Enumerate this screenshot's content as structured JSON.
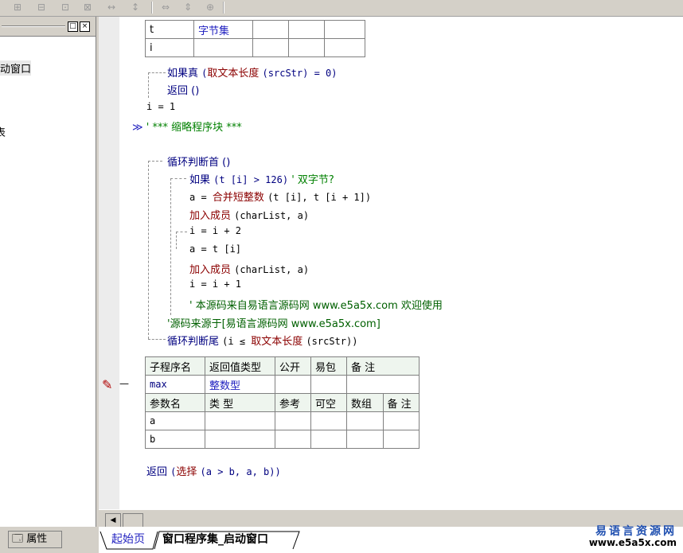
{
  "left_panel": {
    "tree_item_window": "动窗口",
    "tree_item_other": "表",
    "btn_restore": "□",
    "btn_close": "×",
    "properties_tab": "属性"
  },
  "code": {
    "table1": {
      "row1_col1": "t",
      "row1_col2": "字节集",
      "row2_col1": "i"
    },
    "lines": {
      "if_true": "如果真",
      "get_len": "取文本长度",
      "if_true_args": "(srcStr) = 0)",
      "return1": "返回 ()",
      "assign_i": "i = 1",
      "collapsed": "' *** 缩略程序块 ***",
      "loop_start": "循环判断首 ()",
      "if_kw": "如果",
      "if_args": "(t [i] > 126)",
      "if_comment": "' 双字节?",
      "a_assign": "a = ",
      "merge_fn": "合并短整数",
      "merge_args": "(t [i], t [i + 1])",
      "add_member1": "加入成员",
      "add_member1_args": "(charList, a)",
      "i_plus2": "i = i + 2",
      "a_ti": "a = t [i]",
      "add_member2": "加入成员",
      "add_member2_args": "(charList, a)",
      "i_plus1": "i = i + 1",
      "comment1": "' 本源码来自易语言源码网 www.e5a5x.com  欢迎使用",
      "comment2": "'源码来源于[易语言源码网 www.e5a5x.com]",
      "loop_end": "循环判断尾",
      "loop_end_args1": "(i ≤ ",
      "loop_end_fn": "取文本长度",
      "loop_end_args2": "(srcStr))",
      "return_kw": "返回",
      "select_fn": "选择",
      "select_args": "(a > b, a, b))"
    },
    "sub_table": {
      "headers": [
        "子程序名",
        "返回值类型",
        "公开",
        "易包",
        "备 注"
      ],
      "name": "max",
      "return_type": "整数型",
      "param_headers": [
        "参数名",
        "类 型",
        "参考",
        "可空",
        "数组",
        "备 注"
      ],
      "params": [
        "a",
        "b"
      ]
    },
    "breakpoint_dash": "—",
    "collapse_marker": "≫"
  },
  "tabs": {
    "start_page": "起始页",
    "current": "窗口程序集_启动窗口"
  },
  "watermark": {
    "cn": "易语言资源网",
    "url": "www.e5a5x.com"
  },
  "colors": {
    "keyword": "#000080",
    "function": "#8b0000",
    "comment": "#008000"
  }
}
